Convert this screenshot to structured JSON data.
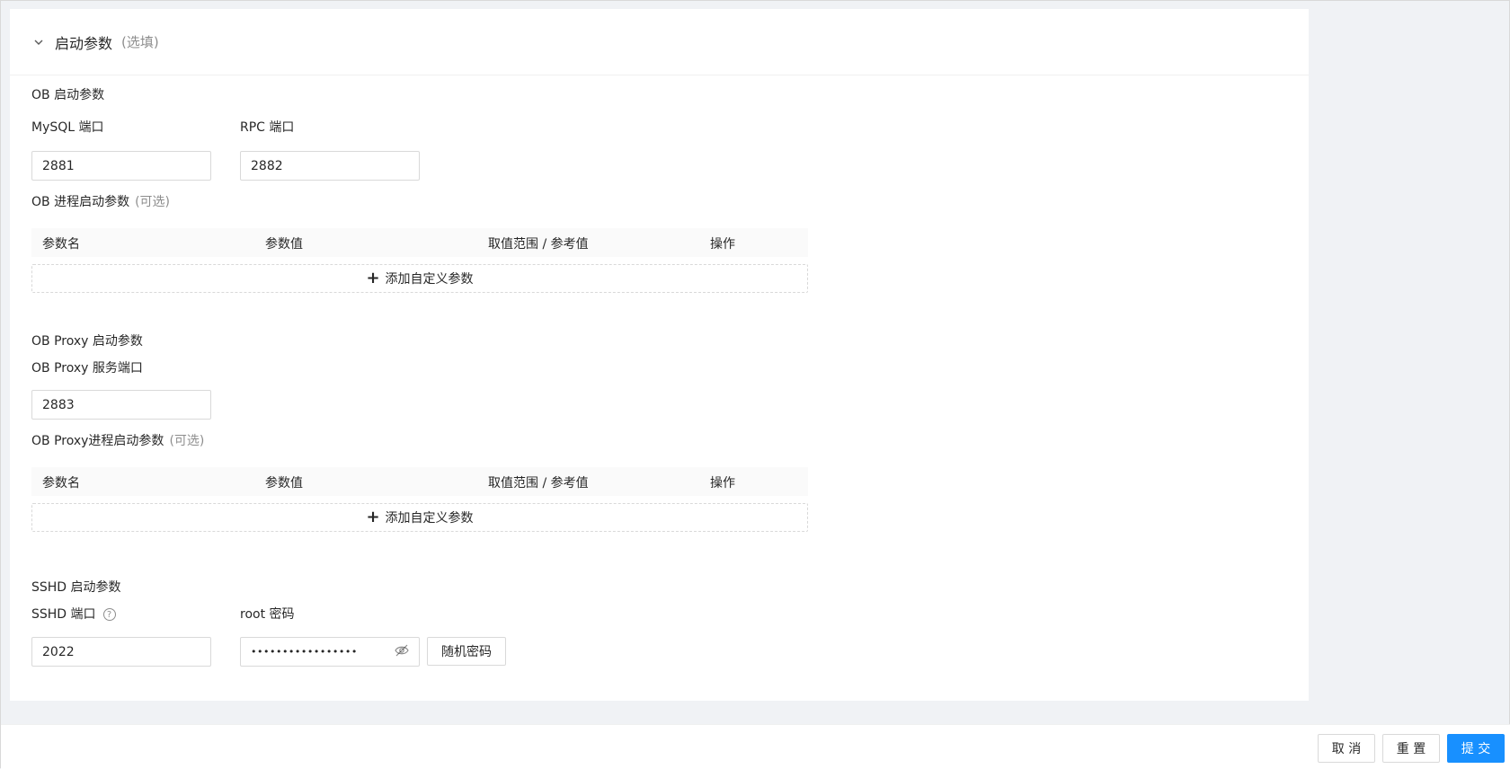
{
  "section": {
    "title": "启动参数",
    "optional_label": "(选填)"
  },
  "ob": {
    "title": "OB 启动参数",
    "mysql_port_label": "MySQL 端口",
    "mysql_port_value": "2881",
    "rpc_port_label": "RPC 端口",
    "rpc_port_value": "2882",
    "process_params_label": "OB 进程启动参数",
    "process_params_optional": "(可选)"
  },
  "table_columns": [
    "参数名",
    "参数值",
    "取值范围 / 参考值",
    "操作"
  ],
  "add_custom_param": "添加自定义参数",
  "proxy": {
    "title": "OB Proxy 启动参数",
    "service_port_label": "OB Proxy 服务端口",
    "service_port_value": "2883",
    "process_params_label": "OB Proxy进程启动参数",
    "process_params_optional": "(可选)"
  },
  "sshd": {
    "title": "SSHD 启动参数",
    "port_label": "SSHD 端口",
    "port_value": "2022",
    "root_password_label": "root 密码",
    "root_password_value": "•••••••••••••••••",
    "random_password_button": "随机密码"
  },
  "footer": {
    "cancel": "取 消",
    "reset": "重 置",
    "submit": "提 交"
  },
  "colors": {
    "primary": "#1890ff",
    "background": "#f0f2f5"
  }
}
